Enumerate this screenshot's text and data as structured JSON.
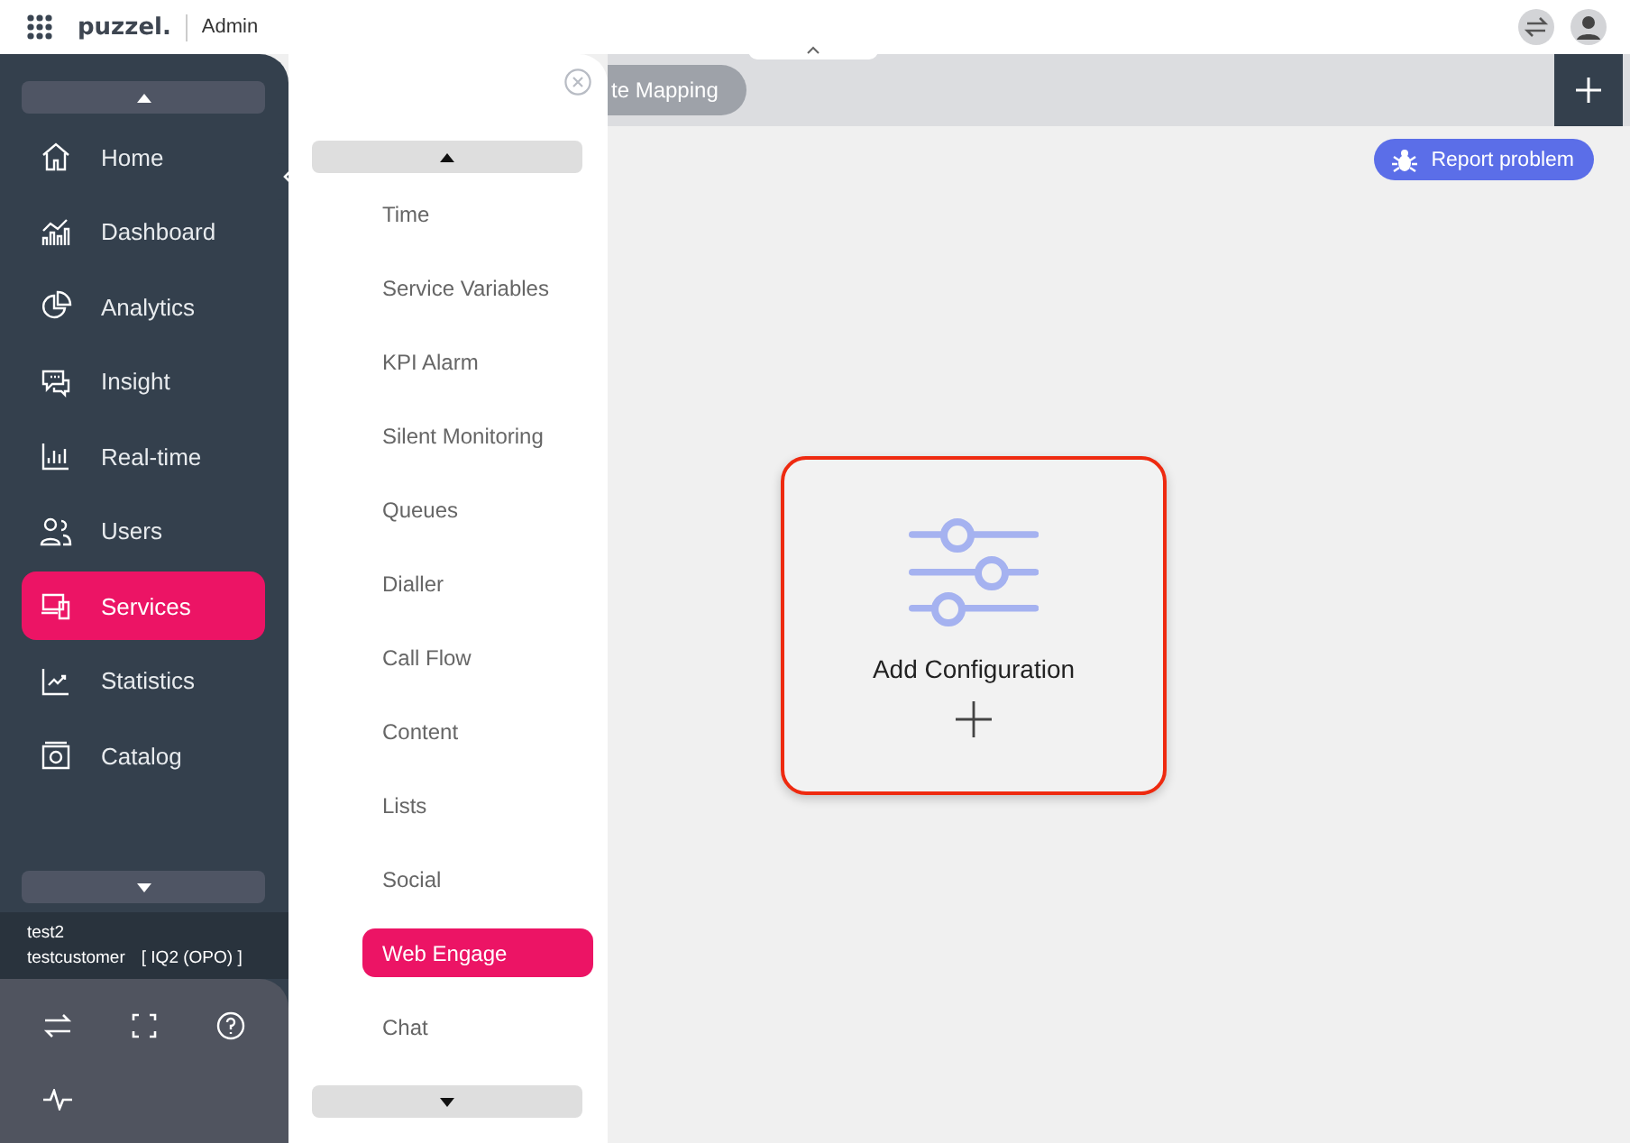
{
  "topbar": {
    "logo": "puzzel.",
    "section": "Admin"
  },
  "sidebar": {
    "items": [
      {
        "label": "Home",
        "selected": false
      },
      {
        "label": "Dashboard",
        "selected": false
      },
      {
        "label": "Analytics",
        "selected": false
      },
      {
        "label": "Insight",
        "selected": false
      },
      {
        "label": "Real-time",
        "selected": false
      },
      {
        "label": "Users",
        "selected": false
      },
      {
        "label": "Services",
        "selected": true
      },
      {
        "label": "Statistics",
        "selected": false
      },
      {
        "label": "Catalog",
        "selected": false
      }
    ],
    "account": {
      "user": "test2",
      "customer": "testcustomer",
      "instance": "[ IQ2 (OPO) ]"
    }
  },
  "submenu": {
    "items": [
      {
        "label": "Time",
        "selected": false
      },
      {
        "label": "Service Variables",
        "selected": false
      },
      {
        "label": "KPI Alarm",
        "selected": false
      },
      {
        "label": "Silent Monitoring",
        "selected": false
      },
      {
        "label": "Queues",
        "selected": false
      },
      {
        "label": "Dialler",
        "selected": false
      },
      {
        "label": "Call Flow",
        "selected": false
      },
      {
        "label": "Content",
        "selected": false
      },
      {
        "label": "Lists",
        "selected": false
      },
      {
        "label": "Social",
        "selected": false
      },
      {
        "label": "Web Engage",
        "selected": true
      },
      {
        "label": "Chat",
        "selected": false
      }
    ]
  },
  "tabs": [
    {
      "label": "te Mapping"
    }
  ],
  "report_button": "Report problem",
  "card": {
    "title": "Add Configuration"
  }
}
